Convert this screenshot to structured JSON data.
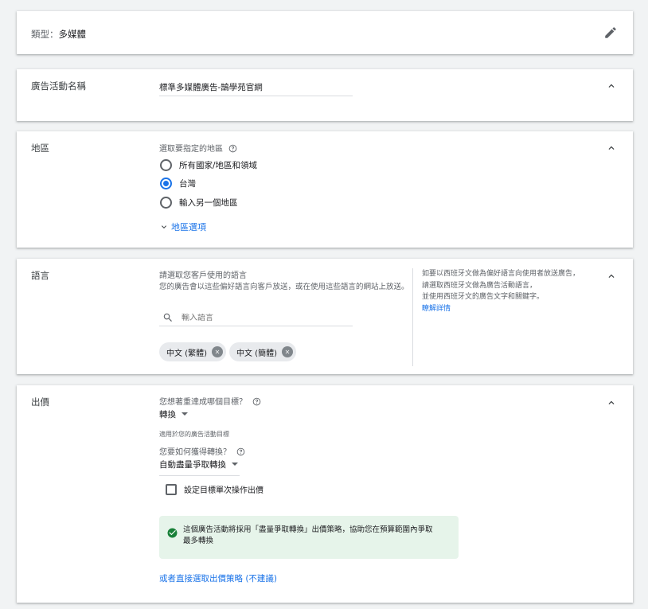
{
  "type_card": {
    "label": "類型：",
    "value": "多媒體",
    "edit_icon": "pencil-icon"
  },
  "campaign_name": {
    "label": "廣告活動名稱",
    "value": "標準多媒體廣告-鵠學苑官網",
    "toggle_icon": "chevron-up-icon"
  },
  "location": {
    "label": "地區",
    "prompt": "選取要指定的地區",
    "options": [
      {
        "label": "所有國家/地區和領域",
        "selected": false
      },
      {
        "label": "台灣",
        "selected": true
      },
      {
        "label": "輸入另一個地區",
        "selected": false
      }
    ],
    "more_options": "地區選項"
  },
  "language": {
    "label": "語言",
    "prompt": "請選取您客戶使用的語言",
    "description": "您的廣告會以這些偏好語言向客戶放送，或在使用這些語言的網站上放送。",
    "search_placeholder": "輸入語言",
    "chips": [
      "中文 (繁體)",
      "中文 (簡體)"
    ],
    "aside_line1": "如要以西班牙文做為偏好語言向使用者放送廣告，",
    "aside_line2": "請選取西班牙文做為廣告活動語言，",
    "aside_line3": "並使用西班牙文的廣告文字和關鍵字。",
    "aside_link": "瞭解詳情"
  },
  "bidding": {
    "label": "出價",
    "goal_question": "您想著重達成哪個目標？",
    "goal_value": "轉換",
    "goal_note": "適用於您的廣告活動目標",
    "how_question": "您要如何獲得轉換？",
    "how_value": "自動盡量爭取轉換",
    "target_cpa_label": "設定目標單次操作出價",
    "info_line1": "這個廣告活動將採用「盡量爭取轉換」出價策略，協助您在預算範圍內爭取",
    "info_line2": "最多轉換",
    "direct_link": "或者直接選取出價策略 (不建議)"
  },
  "colors": {
    "accent": "#1a73e8",
    "success": "#188038",
    "success_bg": "#e6f4ea"
  }
}
